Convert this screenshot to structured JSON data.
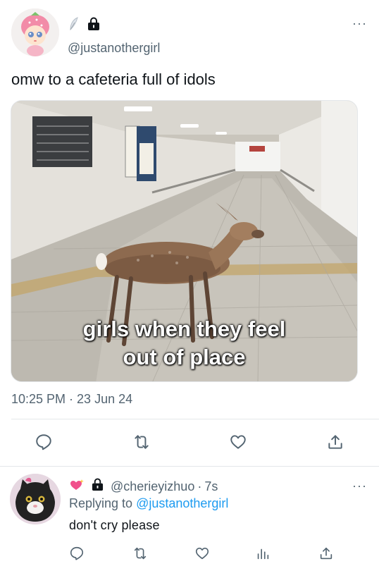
{
  "tweet": {
    "handle": "@justanothergirl",
    "text": "omw to a cafeteria full of idols",
    "image_caption_line1": "girls when they feel",
    "image_caption_line2": "out of place",
    "timestamp": "10:25 PM · 23 Jun 24",
    "more": "···"
  },
  "reply": {
    "handle": "@cherieyizhuo",
    "separator": "·",
    "age": "7s",
    "replying_prefix": "Replying to",
    "replying_to": "@justanothergirl",
    "text": "don't cry please",
    "more": "···"
  },
  "icons": {
    "main_badges": [
      "feather-icon",
      "lock-icon"
    ],
    "reply_badges": [
      "sparkling-heart-icon",
      "lock-icon"
    ],
    "actions": [
      "reply-icon",
      "retweet-icon",
      "like-icon",
      "share-icon"
    ],
    "reply_actions": [
      "reply-icon",
      "retweet-icon",
      "like-icon",
      "analytics-icon",
      "share-icon"
    ]
  },
  "colors": {
    "link": "#1d9bf0",
    "secondary_text": "#536471",
    "primary_text": "#0f1419",
    "divider": "#e4e7ea",
    "heart_badge": "#f0508c"
  }
}
